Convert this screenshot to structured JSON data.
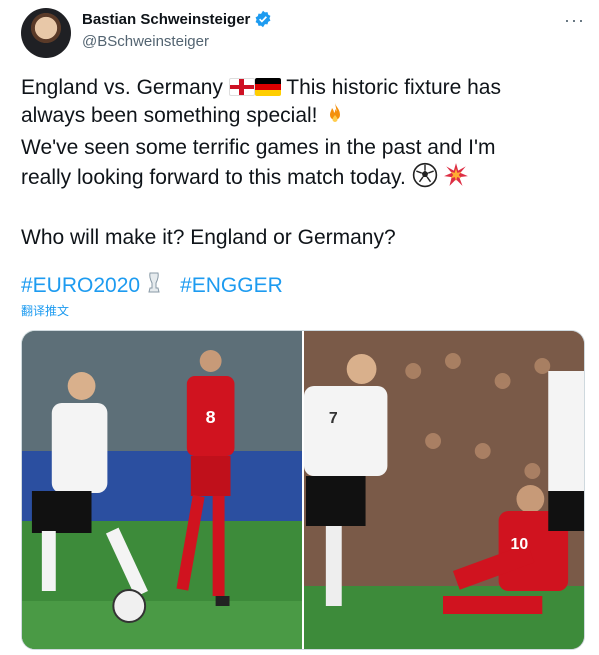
{
  "author": {
    "display_name": "Bastian Schweinsteiger",
    "handle": "@BSchweinsteiger",
    "verified_icon": "verified-badge-icon"
  },
  "more_label": "···",
  "tweet": {
    "line1_a": "England vs. Germany",
    "line1_b": "This historic fixture has",
    "line2": "always been something special!",
    "line3": "We've seen some terrific games in the past and I'm",
    "line4": "really looking forward to this match today.",
    "line5": "Who will make it? England or Germany?"
  },
  "hashtags": [
    "#EURO2020",
    "#ENGGER"
  ],
  "translate_label": "翻译推文",
  "media": {
    "left_jersey": "8",
    "right_jersey_a": "7",
    "right_jersey_b": "10"
  },
  "colors": {
    "link": "#1d9bf0",
    "text": "#0f1419",
    "secondary": "#536471",
    "england_red": "#d0131f",
    "pitch_green": "#3d8b3a"
  }
}
